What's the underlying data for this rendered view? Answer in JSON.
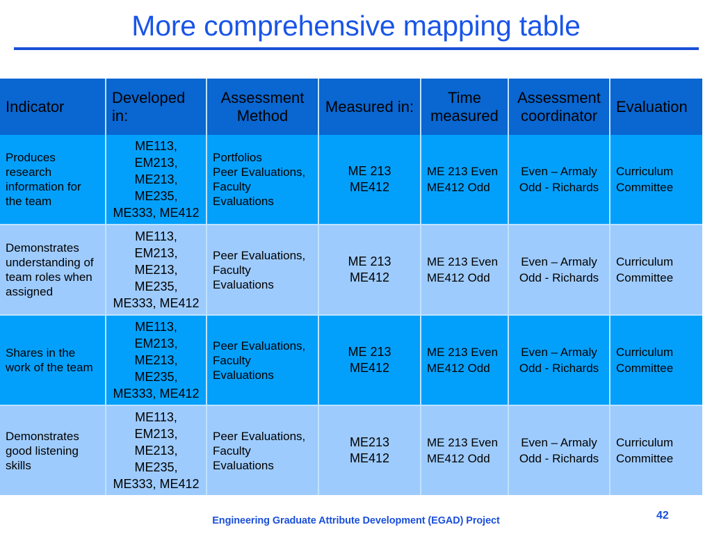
{
  "slide": {
    "title": "More comprehensive mapping table",
    "number": "42",
    "footer": "Engineering Graduate Attribute Development (EGAD) Project",
    "colors": {
      "title": "#1a55e8",
      "rule": "#1a4fd8",
      "header_bg": "#0a66d0",
      "row_dark_bg": "#03a0fb",
      "row_light_bg": "#9ecbfd",
      "grid_line": "#bfe3ff",
      "text": "#000000",
      "footer_text": "#1a4fd8"
    }
  },
  "table": {
    "headers": [
      "Indicator",
      "Developed in:",
      "Assessment Method",
      "Measured in:",
      "Time measured",
      "Assessment coordinator",
      "Evaluation"
    ],
    "rows": [
      {
        "shade": "dark",
        "indicator": "Produces research information for the team",
        "developed_in": "ME113,\nEM213,\nME213,\nME235,\nME333, ME412",
        "assessment_method": "Portfolios\nPeer Evaluations,\nFaculty\nEvaluations",
        "measured_in": "ME 213\nME412",
        "time_measured": "ME 213 Even\nME412 Odd",
        "assessment_coordinator": "Even – Armaly\nOdd - Richards",
        "evaluation": "Curriculum\nCommittee"
      },
      {
        "shade": "light",
        "indicator": "Demonstrates understanding of team roles when assigned",
        "developed_in": "ME113,\nEM213,\nME213,\nME235,\nME333, ME412",
        "assessment_method": "Peer Evaluations,\nFaculty\nEvaluations",
        "measured_in": "ME 213\nME412",
        "time_measured": "ME 213 Even\nME412 Odd",
        "assessment_coordinator": "Even – Armaly\nOdd - Richards",
        "evaluation": "Curriculum\nCommittee"
      },
      {
        "shade": "dark",
        "indicator": "Shares in the work of the team",
        "developed_in": "ME113,\nEM213,\nME213,\nME235,\nME333, ME412",
        "assessment_method": "Peer Evaluations,\nFaculty\nEvaluations",
        "measured_in": "ME 213\nME412",
        "time_measured": "ME 213 Even\nME412 Odd",
        "assessment_coordinator": "Even – Armaly\nOdd - Richards",
        "evaluation": "Curriculum\nCommittee"
      },
      {
        "shade": "light",
        "indicator": "Demonstrates good listening skills",
        "developed_in": "ME113,\nEM213,\nME213,\nME235,\nME333, ME412",
        "assessment_method": "Peer Evaluations,\nFaculty\nEvaluations",
        "measured_in": "ME213\nME412",
        "time_measured": "ME 213 Even\nME412 Odd",
        "assessment_coordinator": "Even – Armaly\nOdd - Richards",
        "evaluation": "Curriculum\nCommittee"
      }
    ]
  }
}
